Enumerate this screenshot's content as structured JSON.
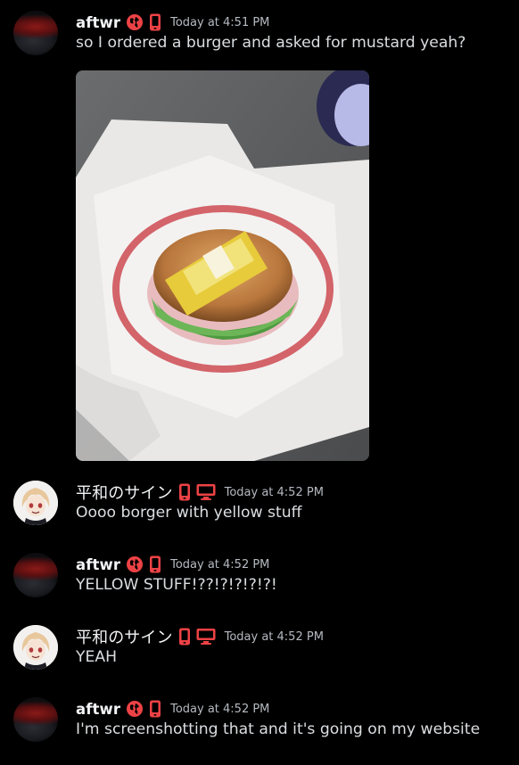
{
  "channel": {
    "messages": [
      {
        "author": "aftwr",
        "timestamp": "Today at 4:51 PM",
        "text": "so I ordered a burger and asked for mustard yeah?",
        "avatar": "red-dark-avatar",
        "icons": [
          "globe-icon",
          "mobile-phone-icon"
        ],
        "attachment": {
          "type": "image",
          "description_icon": "burger-photo-icon"
        }
      },
      {
        "author": "平和のサイン",
        "timestamp": "Today at 4:52 PM",
        "text": "Oooo borger with yellow stuff",
        "avatar": "anime-character-avatar",
        "icons": [
          "mobile-phone-icon",
          "desktop-monitor-icon"
        ]
      },
      {
        "author": "aftwr",
        "timestamp": "Today at 4:52 PM",
        "text": "YELLOW STUFF!??!?!?!?!?!",
        "avatar": "red-dark-avatar",
        "icons": [
          "globe-icon",
          "mobile-phone-icon"
        ]
      },
      {
        "author": "平和のサイン",
        "timestamp": "Today at 4:52 PM",
        "text": "YEAH",
        "avatar": "anime-character-avatar",
        "icons": [
          "mobile-phone-icon",
          "desktop-monitor-icon"
        ]
      },
      {
        "author": "aftwr",
        "timestamp": "Today at 4:52 PM",
        "text": "I'm screenshotting that and it's going on my website",
        "avatar": "red-dark-avatar",
        "icons": [
          "globe-icon",
          "mobile-phone-icon"
        ]
      }
    ]
  },
  "colors": {
    "background": "#000000",
    "username": "#f2f3f5",
    "timestamp": "#b5bac1",
    "message_text": "#dbdee1",
    "status_icon_red": "#ed4245"
  }
}
